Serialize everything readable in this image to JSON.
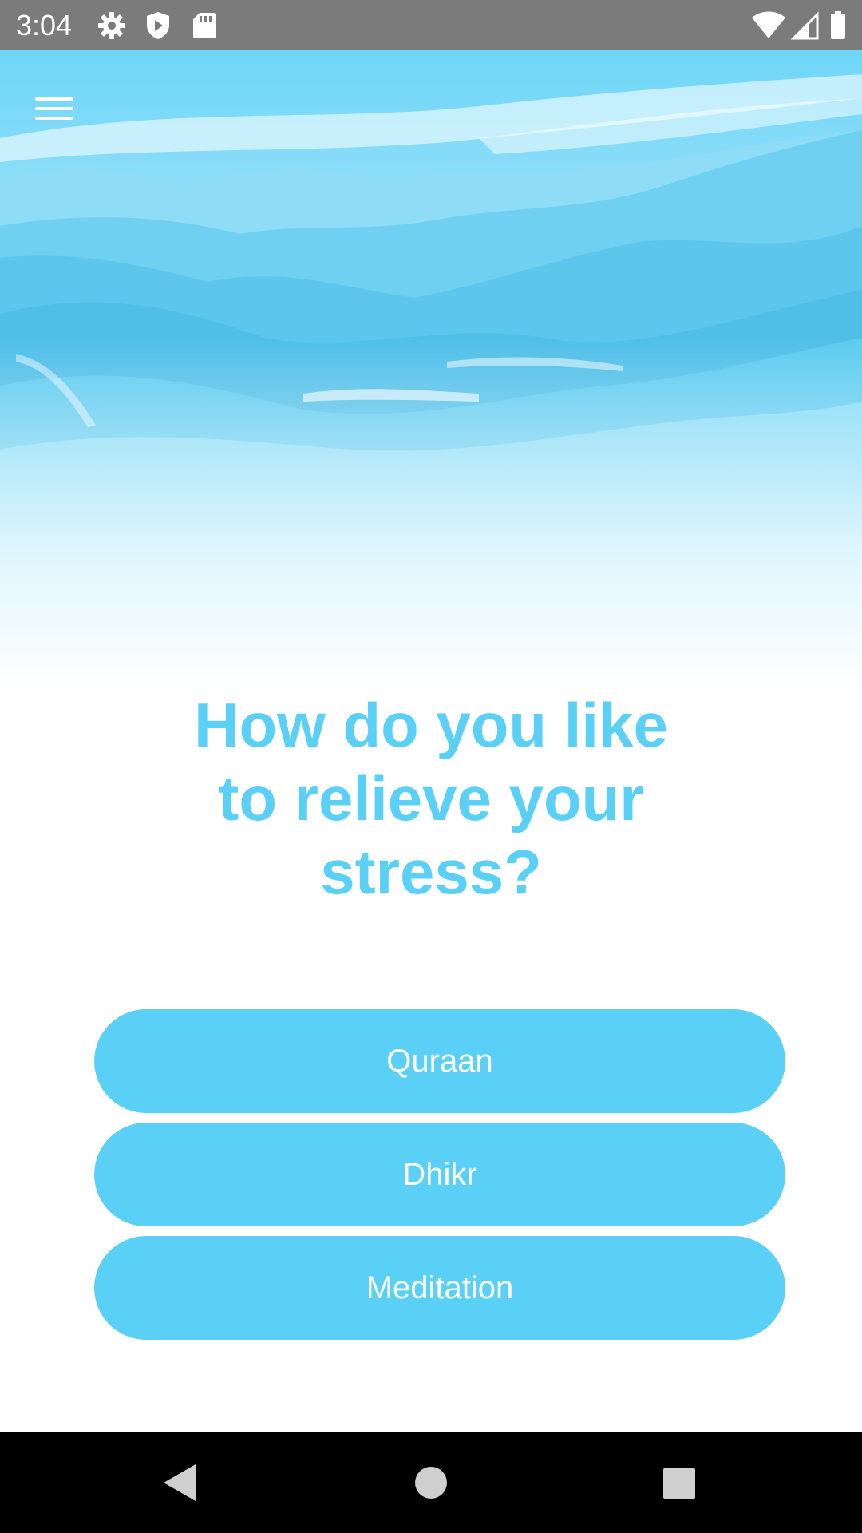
{
  "status_bar": {
    "time": "3:04",
    "left_icons": [
      "settings-icon",
      "shield-icon",
      "sd-card-icon"
    ],
    "right_icons": [
      "wifi-icon",
      "cellular-signal-icon",
      "battery-icon"
    ]
  },
  "header": {
    "menu_icon": "hamburger-menu-icon"
  },
  "main": {
    "headline_lines": [
      "How do you like",
      "to relieve your",
      "stress?"
    ],
    "options": [
      {
        "label": "Quraan"
      },
      {
        "label": "Dhikr"
      },
      {
        "label": "Meditation"
      }
    ]
  },
  "nav_bar": {
    "buttons": [
      "back-icon",
      "home-icon",
      "recents-icon"
    ]
  },
  "colors": {
    "accent": "#5bd0f7",
    "status_bar": "#7b7b7b",
    "nav_bar": "#000000",
    "background": "#ffffff"
  }
}
